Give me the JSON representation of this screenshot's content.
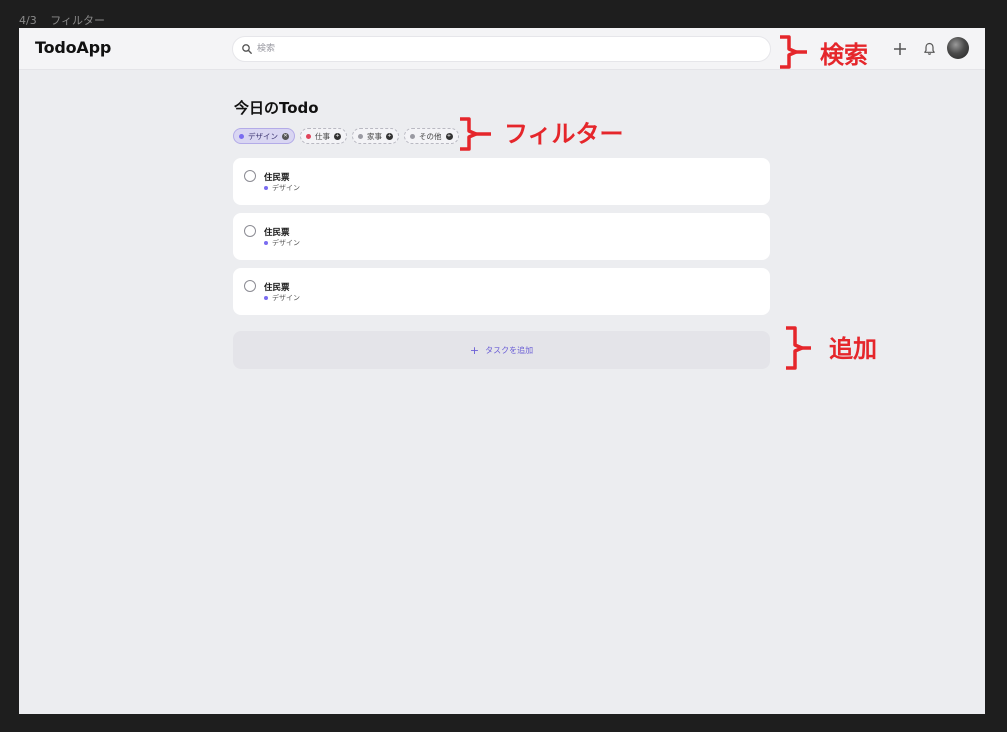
{
  "frame": {
    "number": "4/3",
    "name": "フィルター"
  },
  "header": {
    "logo": "TodoApp",
    "search": {
      "placeholder": "検索",
      "value": "",
      "icon": "search-icon"
    },
    "add_icon": "plus-icon",
    "notification_icon": "bell-icon",
    "avatar_icon": "avatar"
  },
  "main": {
    "title": "今日のTodo",
    "filters": [
      {
        "label": "デザイン",
        "color": "#7a6cf0",
        "active": true
      },
      {
        "label": "仕事",
        "color": "#e0445a",
        "active": false
      },
      {
        "label": "家事",
        "color": "#9a9aa2",
        "active": false
      },
      {
        "label": "その他",
        "color": "#9a9aa2",
        "active": false
      }
    ],
    "tasks": [
      {
        "title": "住民票",
        "tag": "デザイン",
        "tag_color": "#7a6cf0",
        "done": false
      },
      {
        "title": "住民票",
        "tag": "デザイン",
        "tag_color": "#7a6cf0",
        "done": false
      },
      {
        "title": "住民票",
        "tag": "デザイン",
        "tag_color": "#7a6cf0",
        "done": false
      }
    ],
    "add_task_label": "タスクを追加"
  },
  "annotations": {
    "search": "検索",
    "filter": "フィルター",
    "add": "追加",
    "color": "#e5262b"
  },
  "colors": {
    "accent": "#6b5fd6",
    "background": "#ecedf0",
    "header": "#f4f4f6"
  }
}
